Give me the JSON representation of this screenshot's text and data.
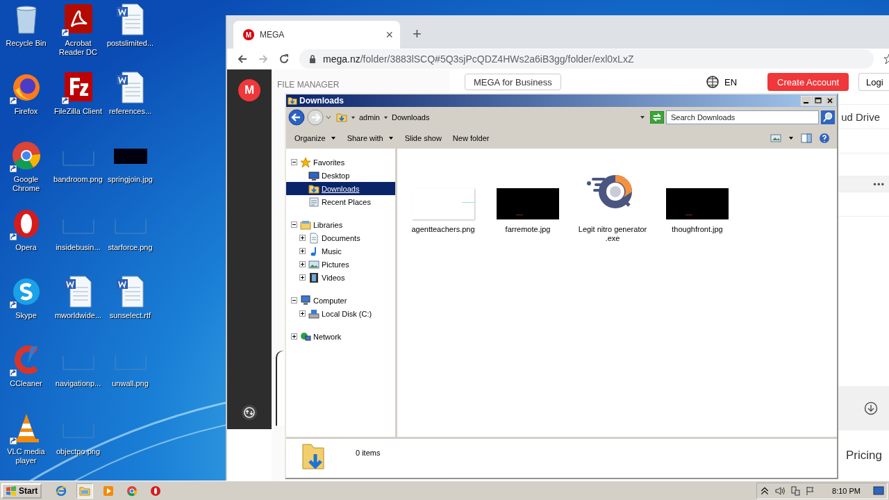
{
  "desktop": {
    "icons": [
      {
        "label": "Recycle Bin",
        "kind": "recycle",
        "shortcut": false
      },
      {
        "label": "Firefox",
        "kind": "firefox",
        "shortcut": true
      },
      {
        "label": "Google Chrome",
        "kind": "chrome",
        "shortcut": true
      },
      {
        "label": "Opera",
        "kind": "opera",
        "shortcut": true
      },
      {
        "label": "Skype",
        "kind": "skype",
        "shortcut": true
      },
      {
        "label": "CCleaner",
        "kind": "ccleaner",
        "shortcut": true
      },
      {
        "label": "VLC media player",
        "kind": "vlc",
        "shortcut": true
      },
      {
        "label": "Acrobat Reader DC",
        "kind": "pdf",
        "shortcut": true
      },
      {
        "label": "FileZilla Client",
        "kind": "filezilla",
        "shortcut": true
      },
      {
        "label": "bandroom.png",
        "kind": "blank",
        "shortcut": false
      },
      {
        "label": "insidebusin...",
        "kind": "blank",
        "shortcut": false
      },
      {
        "label": "mworldwide...",
        "kind": "word",
        "shortcut": false
      },
      {
        "label": "navigationp...",
        "kind": "blank",
        "shortcut": false
      },
      {
        "label": "objectpo.png",
        "kind": "blank",
        "shortcut": false
      },
      {
        "label": "postslimited...",
        "kind": "word",
        "shortcut": false
      },
      {
        "label": "references...",
        "kind": "word",
        "shortcut": false
      },
      {
        "label": "springjoin.jpg",
        "kind": "black",
        "shortcut": false
      },
      {
        "label": "starforce.png",
        "kind": "blank",
        "shortcut": false
      },
      {
        "label": "sunselect.rtf",
        "kind": "word",
        "shortcut": false
      },
      {
        "label": "unwall.png",
        "kind": "blank",
        "shortcut": false
      }
    ]
  },
  "browser": {
    "tab": {
      "favicon_letter": "M",
      "title": "MEGA",
      "close": "×"
    },
    "new_tab": "+",
    "address": {
      "host": "mega.nz",
      "path": "/folder/3883lSCQ#5Q3sjPcQDZ4HWs2a6iB3gg/folder/exl0xLxZ"
    },
    "page": {
      "logo_letter": "M",
      "section_label": "FILE MANAGER",
      "business_button": "MEGA for Business",
      "language": "EN",
      "create_account": "Create Account",
      "login": "Logi",
      "heading": "ud Drive",
      "more": "•••",
      "pricing": "Pricing"
    }
  },
  "explorer": {
    "title": "Downloads",
    "breadcrumb": [
      "admin",
      "Downloads"
    ],
    "search": {
      "placeholder": "Search Downloads"
    },
    "toolbar": [
      {
        "label": "Organize",
        "dropdown": true
      },
      {
        "label": "Share with",
        "dropdown": true
      },
      {
        "label": "Slide show",
        "dropdown": false
      },
      {
        "label": "New folder",
        "dropdown": false
      }
    ],
    "tree": [
      {
        "label": "Favorites",
        "expanded": true,
        "selected": false,
        "children": [
          {
            "label": "Desktop",
            "selected": false
          },
          {
            "label": "Downloads",
            "selected": true
          },
          {
            "label": "Recent Places",
            "selected": false
          }
        ]
      },
      {
        "label": "Libraries",
        "expanded": true,
        "selected": false,
        "children": [
          {
            "label": "Documents",
            "expanded": false,
            "selected": false
          },
          {
            "label": "Music",
            "expanded": false,
            "selected": false
          },
          {
            "label": "Pictures",
            "expanded": false,
            "selected": false
          },
          {
            "label": "Videos",
            "expanded": false,
            "selected": false
          }
        ]
      },
      {
        "label": "Computer",
        "expanded": true,
        "selected": false,
        "children": [
          {
            "label": "Local Disk (C:)",
            "expanded": false,
            "selected": false
          }
        ]
      },
      {
        "label": "Network",
        "expanded": false,
        "selected": false
      }
    ],
    "files": [
      {
        "name": "agentteachers.png",
        "kind": "white"
      },
      {
        "name": "farremote.jpg",
        "kind": "black"
      },
      {
        "name": "Legit nitro generator .exe",
        "kind": "app"
      },
      {
        "name": "thoughfront.jpg",
        "kind": "black"
      }
    ],
    "status": "0 items"
  },
  "taskbar": {
    "start": "Start",
    "items": [
      {
        "kind": "ie",
        "active": false
      },
      {
        "kind": "explorer",
        "active": true
      },
      {
        "kind": "media",
        "active": false
      },
      {
        "kind": "chrome",
        "active": false
      },
      {
        "kind": "opera",
        "active": false
      }
    ],
    "time": "8:10 PM"
  }
}
